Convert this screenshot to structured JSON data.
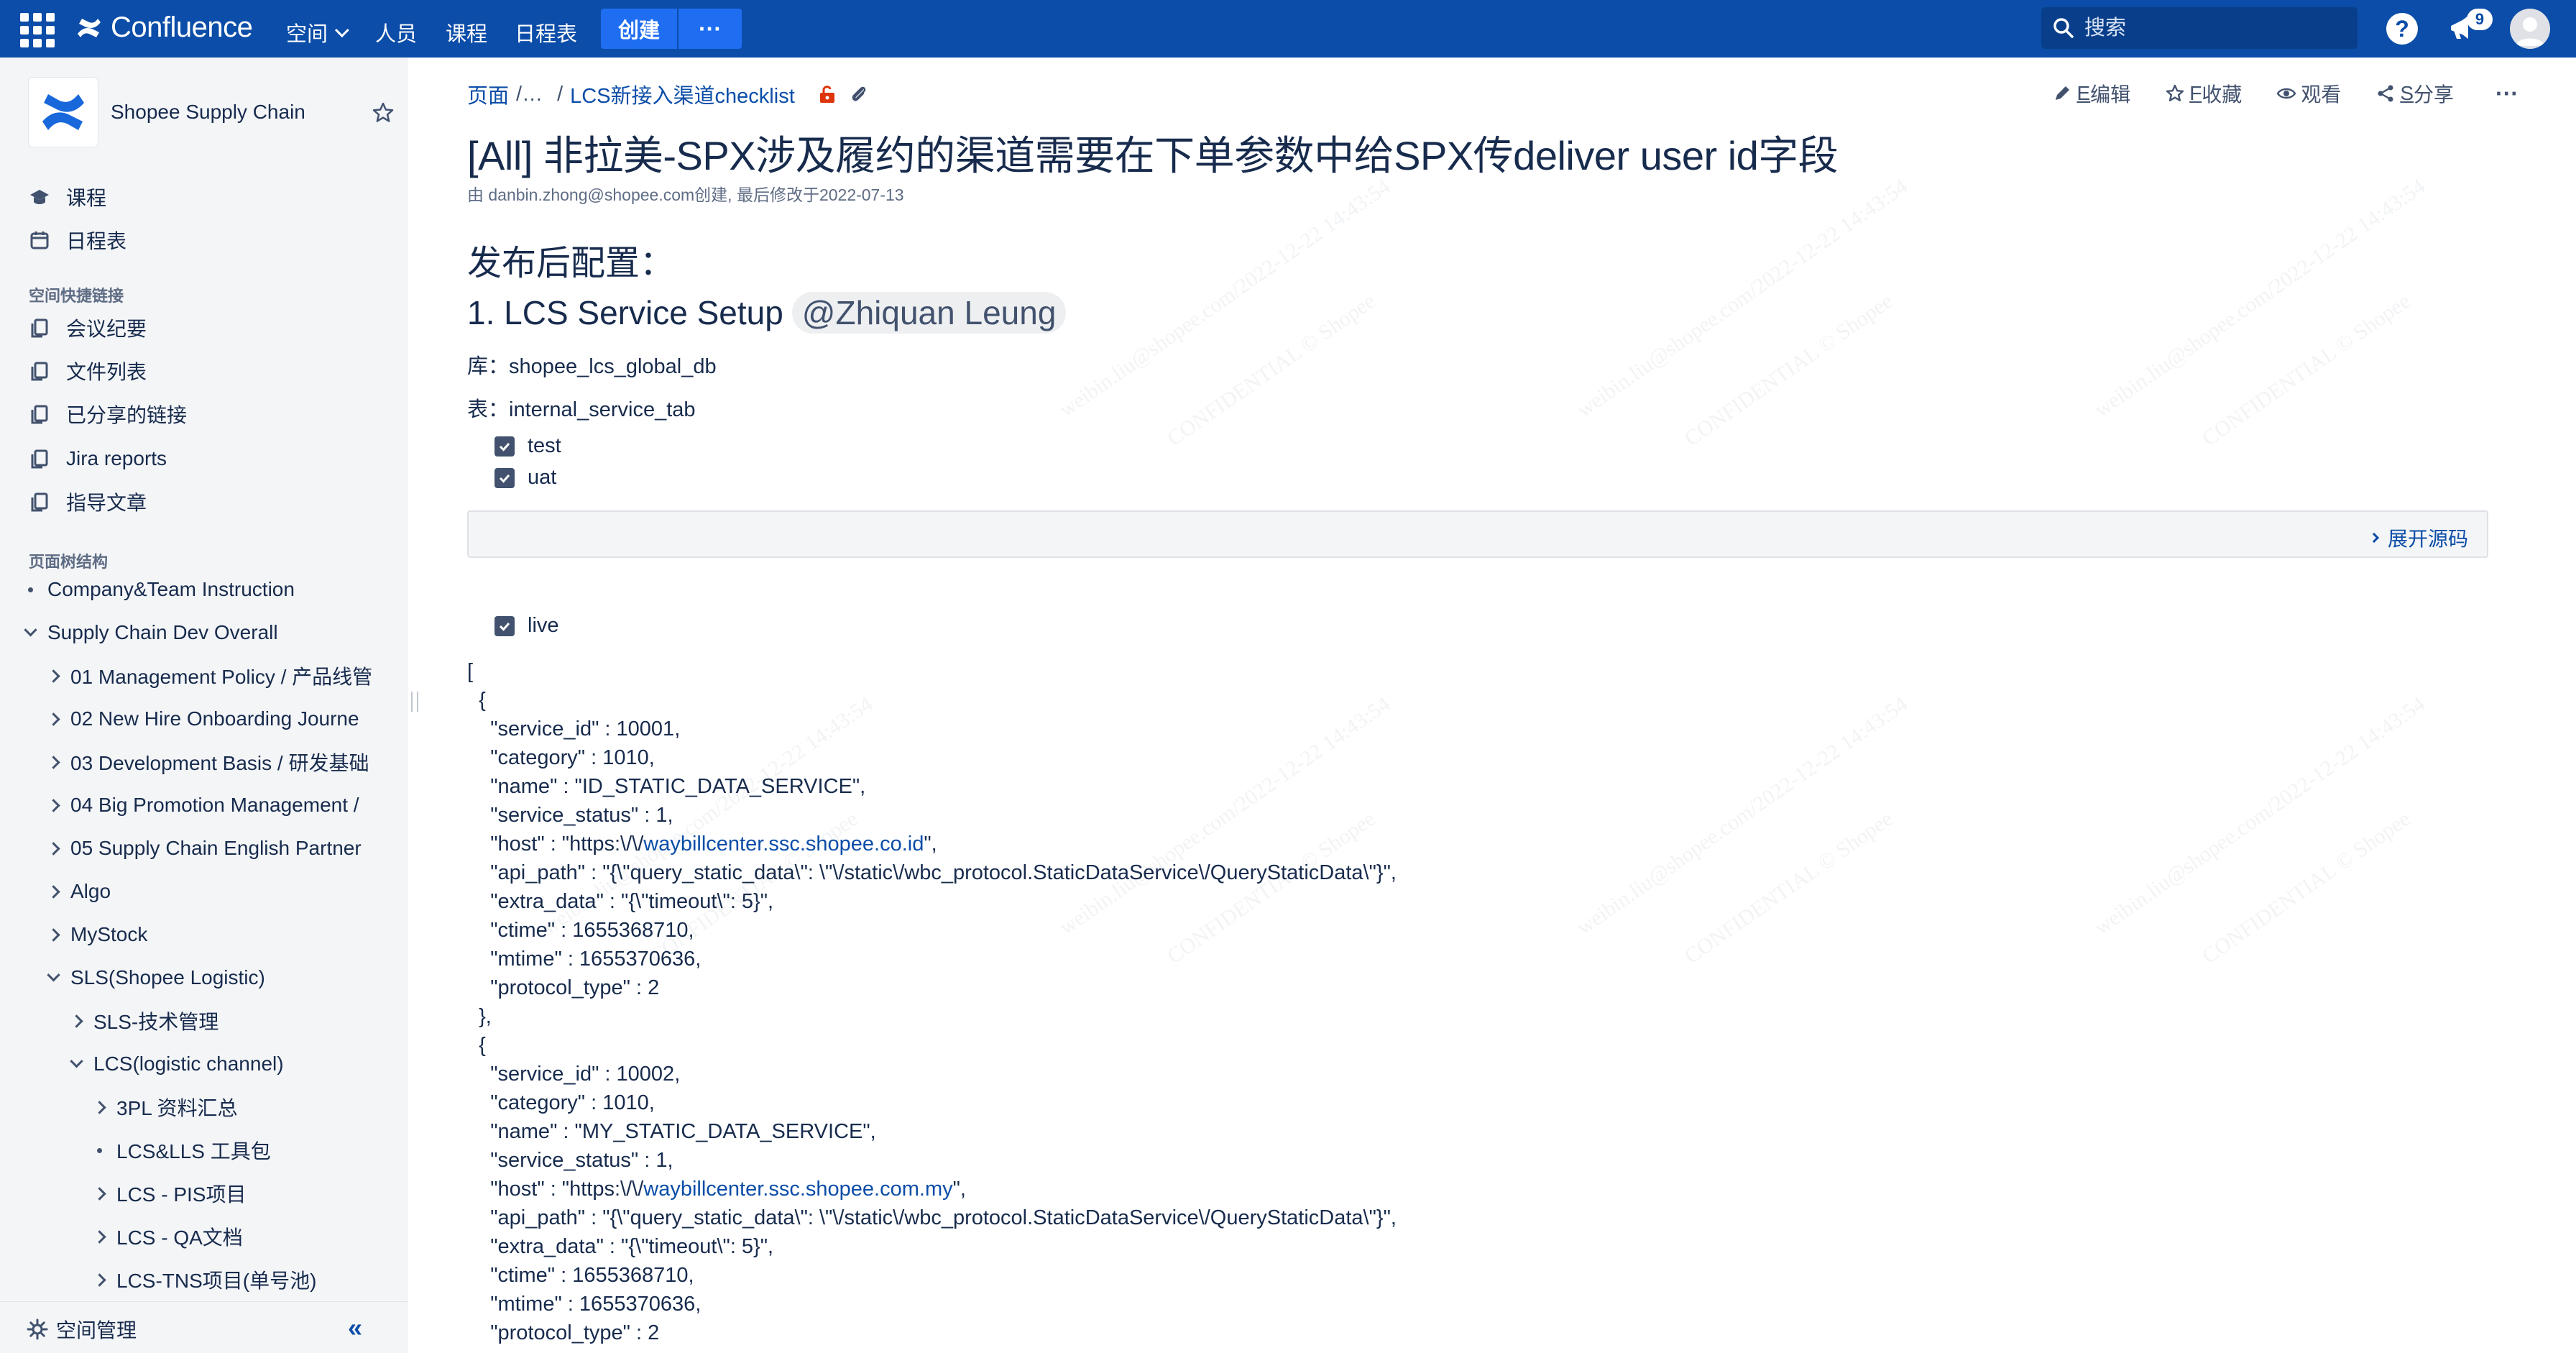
{
  "topnav": {
    "product_name": "Confluence",
    "items": [
      {
        "label": "空间",
        "has_dropdown": true
      },
      {
        "label": "人员"
      },
      {
        "label": "课程"
      },
      {
        "label": "日程表"
      }
    ],
    "create_label": "创建",
    "more_label": "···",
    "search_placeholder": "搜索",
    "notification_count": "9",
    "help_label": "?",
    "brand_color": "#0b4da8"
  },
  "sidebar": {
    "space_name": "Shopee Supply Chain",
    "nav": [
      {
        "label": "课程",
        "icon": "graduation-icon"
      },
      {
        "label": "日程表",
        "icon": "calendar-icon"
      }
    ],
    "shortcuts_heading": "空间快捷链接",
    "shortcuts": [
      {
        "label": "会议纪要"
      },
      {
        "label": "文件列表"
      },
      {
        "label": "已分享的链接"
      },
      {
        "label": "Jira reports"
      },
      {
        "label": "指导文章"
      }
    ],
    "tree_heading": "页面树结构",
    "tree": [
      {
        "label": "Company&Team Instruction",
        "kind": "dot",
        "level": 0
      },
      {
        "label": "Supply Chain Dev Overall",
        "kind": "down",
        "level": 0
      },
      {
        "label": "01 Management Policy / 产品线管",
        "kind": "right",
        "level": 1
      },
      {
        "label": "02 New Hire Onboarding Journe",
        "kind": "right",
        "level": 1
      },
      {
        "label": "03 Development Basis / 研发基础",
        "kind": "right",
        "level": 1
      },
      {
        "label": "04 Big Promotion Management /",
        "kind": "right",
        "level": 1
      },
      {
        "label": "05 Supply Chain English Partner",
        "kind": "right",
        "level": 1
      },
      {
        "label": "Algo",
        "kind": "right",
        "level": 1
      },
      {
        "label": "MyStock",
        "kind": "right",
        "level": 1
      },
      {
        "label": "SLS(Shopee Logistic)",
        "kind": "down",
        "level": 1
      },
      {
        "label": "SLS-技术管理",
        "kind": "right",
        "level": 2
      },
      {
        "label": "LCS(logistic channel)",
        "kind": "down",
        "level": 2
      },
      {
        "label": "3PL 资料汇总",
        "kind": "right",
        "level": 3
      },
      {
        "label": "LCS&LLS 工具包",
        "kind": "dot",
        "level": 3
      },
      {
        "label": "LCS - PIS项目",
        "kind": "right",
        "level": 3
      },
      {
        "label": "LCS - QA文档",
        "kind": "right",
        "level": 3
      },
      {
        "label": "LCS-TNS项目(单号池)",
        "kind": "right",
        "level": 3
      }
    ],
    "space_manage_label": "空间管理",
    "collapse_label": "«"
  },
  "page": {
    "breadcrumb": {
      "root": "页面",
      "ellipsis": "/…",
      "separator": "/",
      "parent": "LCS新接入渠道checklist"
    },
    "actions": [
      {
        "key": "E",
        "label": "编辑",
        "icon": "pencil-icon"
      },
      {
        "key": "F",
        "label": "收藏",
        "icon": "star-icon"
      },
      {
        "key": "",
        "label": "观看",
        "icon": "eye-icon"
      },
      {
        "key": "S",
        "label": "分享",
        "icon": "share-icon"
      },
      {
        "key": "",
        "label": "···",
        "icon": "more-icon"
      }
    ],
    "title": "[All] 非拉美-SPX涉及履约的渠道需要在下单参数中给SPX传deliver user id字段",
    "byline": "由 danbin.zhong@shopee.com创建, 最后修改于2022-07-13",
    "heading_config": "发布后配置：",
    "heading_service": "1. LCS Service Setup",
    "mention": "@Zhiquan Leung",
    "db_line": "库：shopee_lcs_global_db",
    "table_line": "表：internal_service_tab",
    "tasks_env": [
      {
        "label": "test",
        "checked": true
      },
      {
        "label": "uat",
        "checked": true
      }
    ],
    "expand_source_label": "展开源码",
    "task_live": {
      "label": "live",
      "checked": true
    },
    "json_lines": {
      "l00": "[",
      "l01": "  {",
      "l02": "    \"service_id\" : 10001,",
      "l03": "    \"category\" : 1010,",
      "l04": "    \"name\" : \"ID_STATIC_DATA_SERVICE\",",
      "l05": "    \"service_status\" : 1,",
      "l06a": "    \"host\" : \"https:\\/\\/",
      "l06link": "waybillcenter.ssc.shopee.co.id",
      "l06b": "\",",
      "l07": "    \"api_path\" : \"{\\\"query_static_data\\\": \\\"\\/static\\/wbc_protocol.StaticDataService\\/QueryStaticData\\\"}\",",
      "l08": "    \"extra_data\" : \"{\\\"timeout\\\": 5}\",",
      "l09": "    \"ctime\" : 1655368710,",
      "l10": "    \"mtime\" : 1655370636,",
      "l11": "    \"protocol_type\" : 2",
      "l12": "  },",
      "l13": "  {",
      "l14": "    \"service_id\" : 10002,",
      "l15": "    \"category\" : 1010,",
      "l16": "    \"name\" : \"MY_STATIC_DATA_SERVICE\",",
      "l17": "    \"service_status\" : 1,",
      "l18a": "    \"host\" : \"https:\\/\\/",
      "l18link": "waybillcenter.ssc.shopee.com.my",
      "l18b": "\",",
      "l19": "    \"api_path\" : \"{\\\"query_static_data\\\": \\\"\\/static\\/wbc_protocol.StaticDataService\\/QueryStaticData\\\"}\",",
      "l20": "    \"extra_data\" : \"{\\\"timeout\\\": 5}\",",
      "l21": "    \"ctime\" : 1655368710,",
      "l22": "    \"mtime\" : 1655370636,",
      "l23": "    \"protocol_type\" : 2"
    }
  },
  "watermark": {
    "lines": [
      "weibin.liu@shopee.com/2022-12-22 14:43:54",
      "CONFIDENTIAL © Shopee"
    ]
  }
}
